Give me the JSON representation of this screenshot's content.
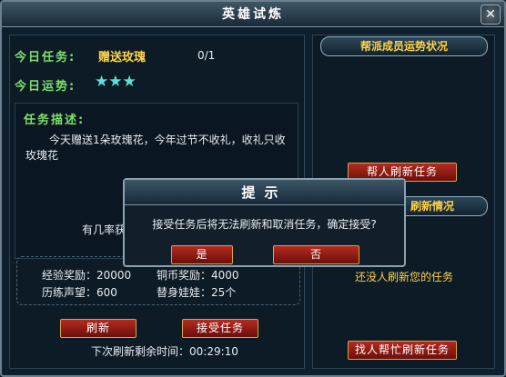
{
  "window": {
    "title": "英雄试炼",
    "close_glyph": "✕"
  },
  "task": {
    "label": "今日任务:",
    "value": "赠送玫瑰",
    "progress": "0/1"
  },
  "luck": {
    "label": "今日运势:",
    "stars": "★★★"
  },
  "description": {
    "label": "任务描述:",
    "text": "今天赠送1朵玫瑰花，今年过节不收礼，收礼只收玫瑰花",
    "partial": "有几率获"
  },
  "rewards": {
    "exp": "经验奖励：20000",
    "coin_partial": "铜币奖励：4000",
    "prestige": "历练声望：600",
    "doll": "替身娃娃：25个"
  },
  "buttons": {
    "refresh": "刷新",
    "accept": "接受任务",
    "help_refresh": "帮人刷新任务",
    "find_help": "找人帮忙刷新任务"
  },
  "timer": "下次刷新剩余时间：00:29:10",
  "right_panel": {
    "banner_top": "帮派成员运势状况",
    "banner_bottom": "刷新情况",
    "text": "还没人刷新您的任务"
  },
  "dialog": {
    "title": "提示",
    "message": "接受任务后将无法刷新和取消任务，确定接受?",
    "yes": "是",
    "no": "否"
  },
  "colors": {
    "accent_gold": "#ffd34a",
    "label_green": "#7de06b",
    "button_red": "#b52b1f",
    "star_cyan": "#5fe0d8"
  }
}
